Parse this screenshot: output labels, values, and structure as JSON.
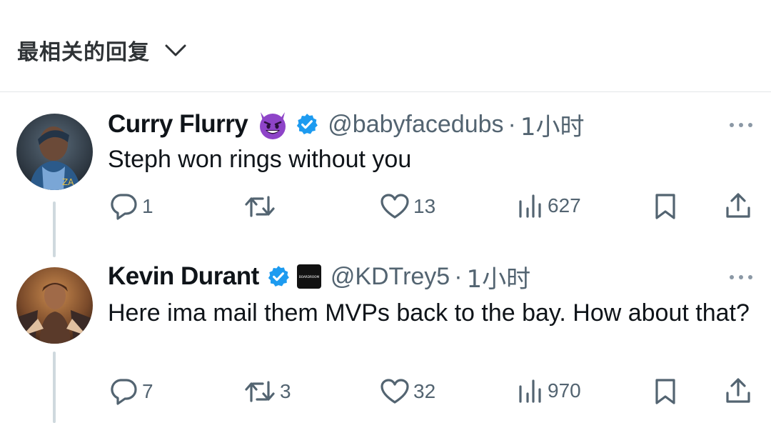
{
  "sort_bar": {
    "label": "最相关的回复"
  },
  "replies": [
    {
      "display_name": "Curry Flurry",
      "handle": "@babyfacedubs",
      "separator": "·",
      "time": "1小时",
      "text": "Steph won rings without you",
      "emoji_badge": "smiling-devil",
      "verified": true,
      "affiliate_badge": null,
      "stats": {
        "replies": "1",
        "reposts": "",
        "likes": "13",
        "views": "627"
      }
    },
    {
      "display_name": "Kevin Durant",
      "handle": "@KDTrey5",
      "separator": "·",
      "time": "1小时",
      "text": "Here ima mail them MVPs back to the bay. How about that?",
      "emoji_badge": null,
      "verified": true,
      "affiliate_badge": "BOARDROOM",
      "stats": {
        "replies": "7",
        "reposts": "3",
        "likes": "32",
        "views": "970"
      }
    }
  ],
  "colors": {
    "verified_blue": "#1d9bf0",
    "text_primary": "#0f1419",
    "text_secondary": "#536471",
    "divider": "#e3e6e8",
    "thread_line": "#cfd9de",
    "emoji_purple": "#8e44c8"
  },
  "icons": {
    "reply": "reply-icon",
    "repost": "repost-icon",
    "like": "heart-icon",
    "views": "views-icon",
    "bookmark": "bookmark-icon",
    "share": "share-icon",
    "more": "more-icon",
    "verified": "verified-badge-icon",
    "chevron": "chevron-down-icon"
  }
}
